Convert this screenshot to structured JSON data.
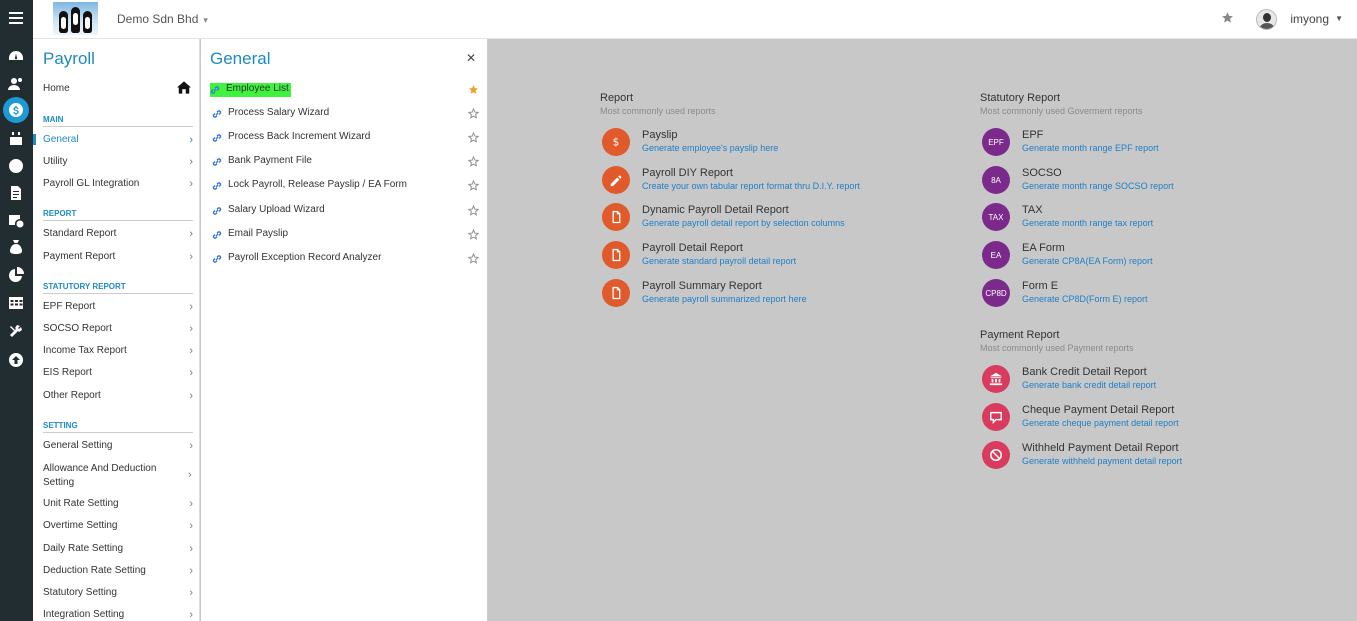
{
  "topbar": {
    "company": "Demo Sdn Bhd",
    "username": "imyong"
  },
  "rail": {
    "icons": [
      "dashboard-icon",
      "user-group-icon",
      "payroll-icon",
      "calendar-icon",
      "clock-icon",
      "document-icon",
      "calendar-clock-icon",
      "money-bag-icon",
      "pie-chart-icon",
      "table-icon",
      "tools-icon",
      "upload-icon"
    ],
    "active": "payroll-icon"
  },
  "menu": {
    "title": "Payroll",
    "home": "Home",
    "sections": {
      "main": "MAIN",
      "report": "REPORT",
      "statutory": "STATUTORY REPORT",
      "setting": "SETTING"
    },
    "main_items": [
      "General",
      "Utility",
      "Payroll GL Integration"
    ],
    "report_items": [
      "Standard Report",
      "Payment Report"
    ],
    "statutory_items": [
      "EPF Report",
      "SOCSO Report",
      "Income Tax Report",
      "EIS Report",
      "Other Report"
    ],
    "setting_items": [
      "General Setting",
      "Allowance And Deduction Setting",
      "Unit Rate Setting",
      "Overtime Setting",
      "Daily Rate Setting",
      "Deduction Rate Setting",
      "Statutory Setting",
      "Integration Setting"
    ]
  },
  "general": {
    "title": "General",
    "items": [
      {
        "label": "Employee List",
        "starred": true
      },
      {
        "label": "Process Salary Wizard",
        "starred": false
      },
      {
        "label": "Process Back Increment Wizard",
        "starred": false
      },
      {
        "label": "Bank Payment File",
        "starred": false
      },
      {
        "label": "Lock Payroll, Release Payslip / EA Form",
        "starred": false
      },
      {
        "label": "Salary Upload Wizard",
        "starred": false
      },
      {
        "label": "Email Payslip",
        "starred": false
      },
      {
        "label": "Payroll Exception Record Analyzer",
        "starred": false
      }
    ]
  },
  "report": {
    "title": "Report",
    "subtitle": "Most commonly used reports",
    "items": [
      {
        "title": "Payslip",
        "desc": "Generate employee's payslip here",
        "icon": "dollar-icon"
      },
      {
        "title": "Payroll DIY Report",
        "desc": "Create your own tabular report format thru D.I.Y. report",
        "icon": "pencil-icon"
      },
      {
        "title": "Dynamic Payroll Detail Report",
        "desc": "Generate payroll detail report by selection columns",
        "icon": "document-icon"
      },
      {
        "title": "Payroll Detail Report",
        "desc": "Generate standard payroll detail report",
        "icon": "document-icon"
      },
      {
        "title": "Payroll Summary Report",
        "desc": "Generate payroll summarized report here",
        "icon": "document-icon"
      }
    ]
  },
  "statutory": {
    "title": "Statutory Report",
    "subtitle": "Most commonly used Goverment reports",
    "items": [
      {
        "badge": "EPF",
        "title": "EPF",
        "desc": "Generate month range EPF report"
      },
      {
        "badge": "8A",
        "title": "SOCSO",
        "desc": "Generate month range SOCSO report"
      },
      {
        "badge": "TAX",
        "title": "TAX",
        "desc": "Generate month range tax report"
      },
      {
        "badge": "EA",
        "title": "EA Form",
        "desc": "Generate CP8A(EA Form) report"
      },
      {
        "badge": "CP8D",
        "title": "Form E",
        "desc": "Generate CP8D(Form E) report"
      }
    ]
  },
  "payment": {
    "title": "Payment Report",
    "subtitle": "Most commonly used Payment reports",
    "items": [
      {
        "title": "Bank Credit Detail Report",
        "desc": "Generate bank credit detail report",
        "icon": "bank-icon"
      },
      {
        "title": "Cheque Payment Detail Report",
        "desc": "Generate cheque payment detail report",
        "icon": "cheque-icon"
      },
      {
        "title": "Withheld Payment Detail Report",
        "desc": "Generate withheld payment detail report",
        "icon": "ban-icon"
      }
    ]
  },
  "colors": {
    "accent": "#1e8bc3",
    "report_icon": "#e05a2b",
    "statutory_icon": "#7b2a8c",
    "payment_icon": "#d93b5e",
    "highlight": "#3ef23e",
    "star_active": "#f0a030"
  }
}
